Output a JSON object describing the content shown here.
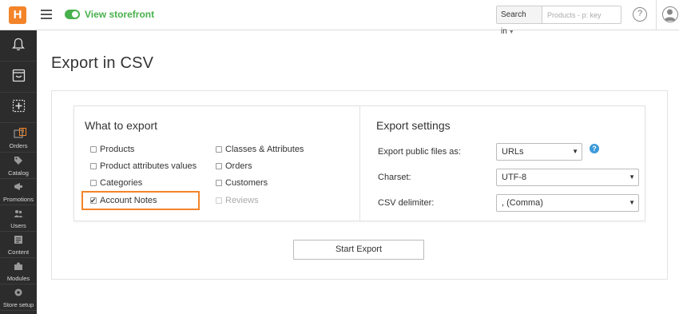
{
  "header": {
    "logo_text": "H",
    "storefront_label": "View storefront",
    "search_scope": "Search in",
    "search_placeholder": "Products - p: key"
  },
  "sidebar": {
    "items": [
      {
        "label": "Orders",
        "icon": "orders-icon",
        "badge": "9"
      },
      {
        "label": "Catalog",
        "icon": "tag-icon"
      },
      {
        "label": "Promotions",
        "icon": "promotions-icon"
      },
      {
        "label": "Users",
        "icon": "users-icon"
      },
      {
        "label": "Content",
        "icon": "content-icon"
      },
      {
        "label": "Modules",
        "icon": "puzzle-icon"
      },
      {
        "label": "Store setup",
        "icon": "store-setup-icon"
      }
    ]
  },
  "page": {
    "title": "Export in CSV"
  },
  "what_to_export": {
    "title": "What to export",
    "options": [
      {
        "label": "Products",
        "checked": false,
        "disabled": false
      },
      {
        "label": "Product attributes values",
        "checked": false,
        "disabled": false
      },
      {
        "label": "Categories",
        "checked": false,
        "disabled": false
      },
      {
        "label": "Account Notes",
        "checked": true,
        "disabled": false
      },
      {
        "label": "Classes & Attributes",
        "checked": false,
        "disabled": false
      },
      {
        "label": "Orders",
        "checked": false,
        "disabled": false
      },
      {
        "label": "Customers",
        "checked": false,
        "disabled": false
      },
      {
        "label": "Reviews",
        "checked": false,
        "disabled": true
      }
    ]
  },
  "export_settings": {
    "title": "Export settings",
    "public_files_label": "Export public files as:",
    "public_files_value": "URLs",
    "charset_label": "Charset:",
    "charset_value": "UTF-8",
    "delimiter_label": "CSV delimiter:",
    "delimiter_value": ", (Comma)"
  },
  "actions": {
    "start_export": "Start Export"
  },
  "colors": {
    "accent": "#f3842a",
    "storefront_green": "#48b04c",
    "help_blue": "#3a9ad9",
    "sidebar_bg": "#2c2c2c"
  }
}
